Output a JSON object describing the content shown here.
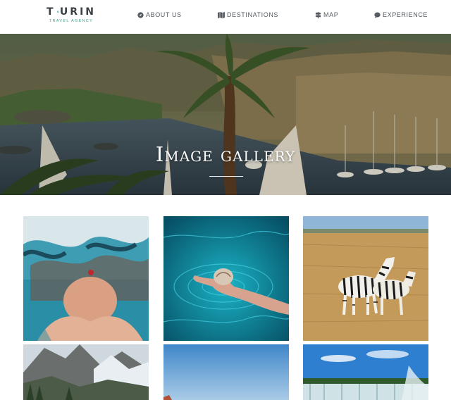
{
  "brand": {
    "name": "TOURIN",
    "name_left": "T",
    "name_right": "URIN",
    "tagline": "TRAVEL AGENCY"
  },
  "nav": {
    "items": [
      {
        "label": "ABOUT US",
        "icon": "compass-icon"
      },
      {
        "label": "DESTINATIONS",
        "icon": "map-fold-icon"
      },
      {
        "label": "MAP",
        "icon": "signpost-icon"
      },
      {
        "label": "EXPERIENCE",
        "icon": "chat-bubble-icon"
      }
    ]
  },
  "hero": {
    "title": "Image gallery",
    "scene": "river-with-palm-and-sailboats"
  },
  "gallery": {
    "items": [
      {
        "subject": "underwater-swimmer"
      },
      {
        "subject": "hand-holding-shell-in-water"
      },
      {
        "subject": "zebras-on-savanna"
      },
      {
        "subject": "mountains-and-glacier"
      },
      {
        "subject": "blue-sky"
      },
      {
        "subject": "waterfall"
      }
    ]
  },
  "colors": {
    "accent": "#3aa58f",
    "nav_text": "#555b61",
    "logo_text": "#3a3f44"
  }
}
